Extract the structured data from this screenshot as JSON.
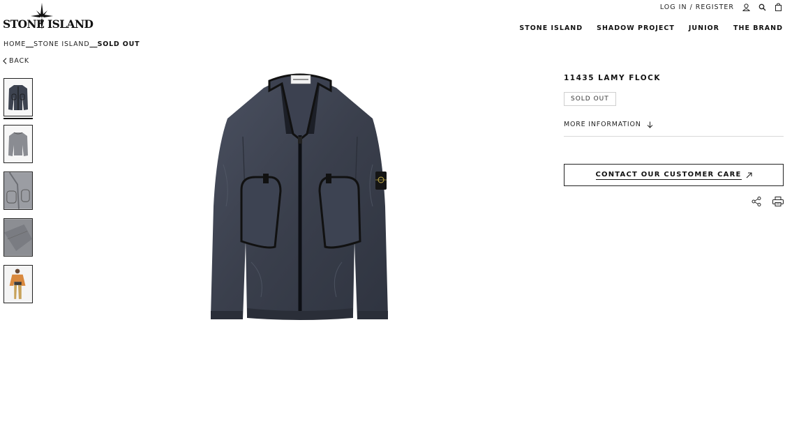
{
  "brand": {
    "logo_text": "STONE ISLAND"
  },
  "utility": {
    "login_label": "LOG IN / REGISTER",
    "icons": [
      "user-icon",
      "search-icon",
      "bag-icon"
    ]
  },
  "nav": {
    "items": [
      "STONE ISLAND",
      "SHADOW PROJECT",
      "JUNIOR",
      "THE BRAND"
    ]
  },
  "breadcrumb": {
    "home": "HOME",
    "separator": "__",
    "category": "STONE ISLAND",
    "current": "SOLD OUT"
  },
  "back_label": "BACK",
  "thumbnails": [
    {
      "name": "front view",
      "active": true
    },
    {
      "name": "back view",
      "active": false
    },
    {
      "name": "detail view",
      "active": false
    },
    {
      "name": "fabric view",
      "active": false
    },
    {
      "name": "model view",
      "active": false
    }
  ],
  "product": {
    "title": "11435 LAMY FLOCK",
    "status": "SOLD OUT",
    "more_info_label": "MORE INFORMATION",
    "contact_label": "CONTACT OUR CUSTOMER CARE",
    "color": "#3d4350"
  },
  "actions": {
    "icons": [
      "share-icon",
      "print-icon"
    ]
  }
}
